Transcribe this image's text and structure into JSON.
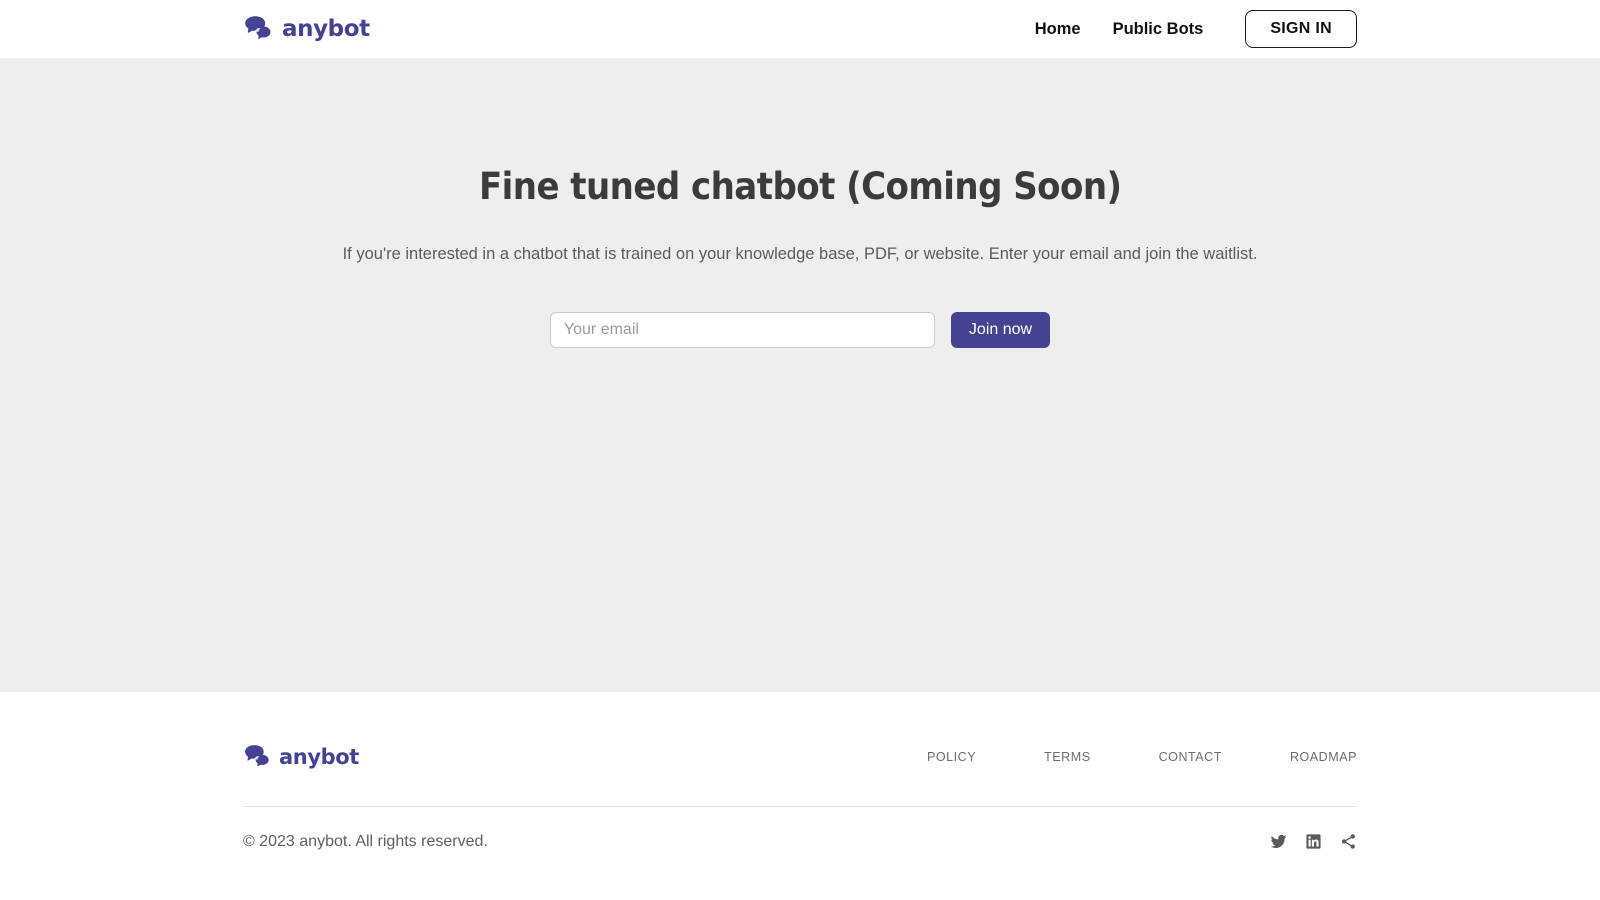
{
  "brand": {
    "name": "anybot",
    "logo_icon": "speech-bubbles-icon",
    "color": "#454391"
  },
  "header": {
    "nav": [
      {
        "label": "Home",
        "name": "nav-link-home"
      },
      {
        "label": "Public Bots",
        "name": "nav-link-public-bots"
      }
    ],
    "signin_label": "SIGN IN"
  },
  "hero": {
    "title": "Fine tuned chatbot (Coming Soon)",
    "subtitle": "If you're interested in a chatbot that is trained on your knowledge base, PDF, or website. Enter your email and join the waitlist.",
    "email_placeholder": "Your email",
    "email_value": "",
    "submit_label": "Join now",
    "background": "#eeeeee",
    "accent": "#454391"
  },
  "footer": {
    "links": [
      {
        "label": "POLICY"
      },
      {
        "label": "TERMS"
      },
      {
        "label": "CONTACT"
      },
      {
        "label": "ROADMAP"
      }
    ],
    "copyright": "© 2023 anybot. All rights reserved.",
    "socials": [
      {
        "name": "twitter-icon"
      },
      {
        "name": "linkedin-icon"
      },
      {
        "name": "share-icon"
      }
    ]
  }
}
